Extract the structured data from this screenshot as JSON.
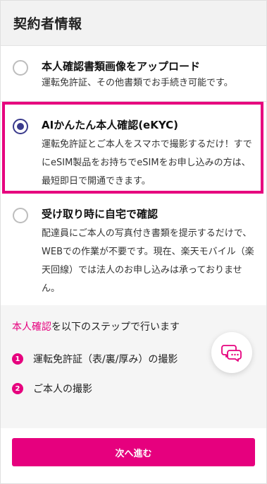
{
  "header": {
    "title": "契約者情報"
  },
  "options": [
    {
      "title": "本人確認書類画像をアップロード",
      "desc": "運転免許証、その他書類でお手続き可能です。",
      "selected": false
    },
    {
      "title": "AIかんたん本人確認(eKYC)",
      "desc": "運転免許証とご本人をスマホで撮影するだけ！すでにeSIM製品をお持ちでeSIMをお申し込みの方は、最短即日で開通できます。",
      "selected": true
    },
    {
      "title": "受け取り時に自宅で確認",
      "desc": "配達員にご本人の写真付き書類を提示するだけで、WEBでの作業が不要です。現在、楽天モバイル（楽天回線）では法人のお申し込みは承っておりません。",
      "selected": false
    }
  ],
  "steps": {
    "heading_accent": "本人確認",
    "heading_rest": "を以下のステップで行います",
    "items": [
      {
        "num": "1",
        "label": "運転免許証（表/裏/厚み）の撮影"
      },
      {
        "num": "2",
        "label": "ご本人の撮影"
      }
    ]
  },
  "chat": {
    "icon": "chat-bubbles-icon"
  },
  "footer": {
    "next_label": "次へ進む"
  },
  "colors": {
    "accent": "#e6007e",
    "radio_selected": "#3a3a8c"
  }
}
